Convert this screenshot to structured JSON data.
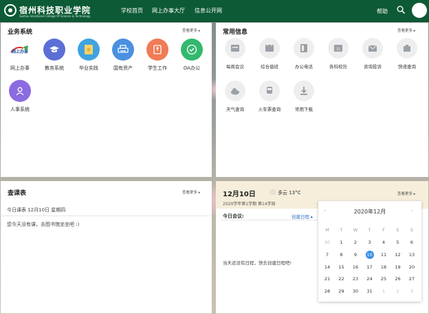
{
  "header": {
    "school_name": "宿州科技职业学院",
    "school_en": "Suzhou Vocational College Of Science & Technology",
    "nav": [
      "学校首页",
      "网上办事大厅",
      "信息公开网"
    ],
    "help": "帮助"
  },
  "business": {
    "title": "业务系统",
    "more": "查看更多",
    "apps": [
      {
        "label": "网上办事",
        "color": "#ffffff",
        "icon": "online-service-logo"
      },
      {
        "label": "教务系统",
        "color": "#5b6fd6",
        "icon": "graduation-cap-icon"
      },
      {
        "label": "毕业实践",
        "color": "#3ea3e0",
        "icon": "certificate-icon"
      },
      {
        "label": "国有资产",
        "color": "#4a90e0",
        "icon": "printer-icon"
      },
      {
        "label": "学生工作",
        "color": "#f07b56",
        "icon": "book-icon"
      },
      {
        "label": "OA办公",
        "color": "#33b86e",
        "icon": "check-icon"
      },
      {
        "label": "人事系统",
        "color": "#8b6be0",
        "icon": "person-icon"
      }
    ]
  },
  "common": {
    "title": "常用信息",
    "more": "查看更多",
    "items": [
      {
        "label": "每周会议",
        "icon": "calendar-icon"
      },
      {
        "label": "综合值班",
        "icon": "duty-calendar-icon"
      },
      {
        "label": "办公电话",
        "icon": "phone-book-icon"
      },
      {
        "label": "各科校历",
        "icon": "school-calendar-icon"
      },
      {
        "label": "咨询投诉",
        "icon": "envelope-icon"
      },
      {
        "label": "快递查询",
        "icon": "package-icon"
      },
      {
        "label": "天气查询",
        "icon": "cloud-icon"
      },
      {
        "label": "火车票查询",
        "icon": "train-icon"
      },
      {
        "label": "常用下载",
        "icon": "download-icon"
      }
    ]
  },
  "schedule": {
    "title": "查课表",
    "more": "查看更多",
    "today_label": "今日课表  12月10日 星期四",
    "empty_text": "您今天没有课，去图书馆坐坐吧 :)"
  },
  "calendar": {
    "date": "12月10日",
    "weather": "多云 13°C",
    "more": "查看更多",
    "term": "2020学年第1学期 第14学周",
    "today_meeting": "今日会议:",
    "create_label": "创建日程",
    "empty_text": "当天还没有日程，快去创建日程吧!",
    "month_title": "2020年12月",
    "weekdays": [
      "M",
      "T",
      "W",
      "T",
      "F",
      "S",
      "S"
    ],
    "weeks": [
      [
        "30",
        "1",
        "2",
        "3",
        "4",
        "5",
        "6"
      ],
      [
        "7",
        "8",
        "9",
        "10",
        "11",
        "12",
        "13"
      ],
      [
        "14",
        "15",
        "16",
        "17",
        "18",
        "19",
        "20"
      ],
      [
        "21",
        "22",
        "23",
        "24",
        "25",
        "26",
        "27"
      ],
      [
        "28",
        "29",
        "30",
        "31",
        "1",
        "2",
        "3"
      ]
    ],
    "today": "10",
    "accent": "#3a8ee6"
  }
}
